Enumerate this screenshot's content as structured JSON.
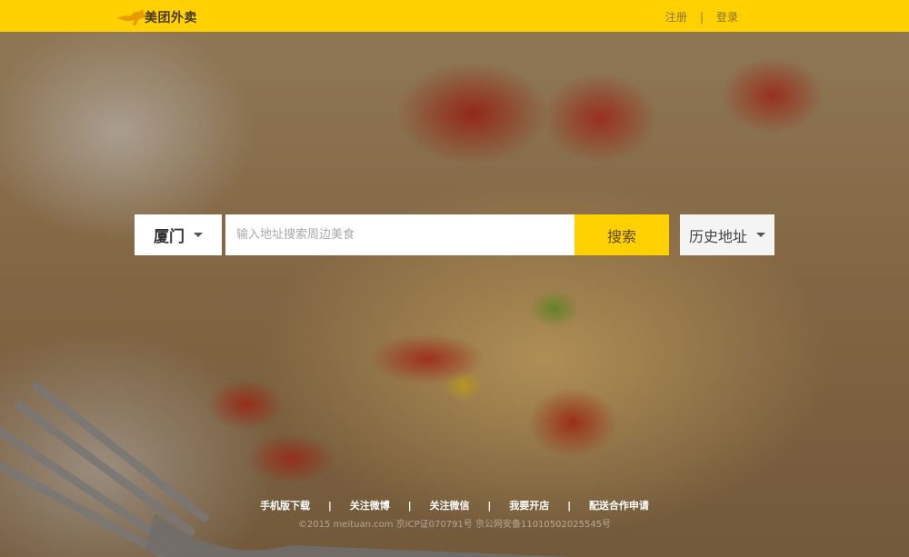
{
  "header": {
    "logo_text": "美团外卖",
    "logo_icon": "kangaroo-icon",
    "register_label": "注册",
    "separator": "|",
    "login_label": "登录"
  },
  "search": {
    "city": "厦门",
    "placeholder": "输入地址搜索周边美食",
    "value": "",
    "search_label": "搜索",
    "history_label": "历史地址"
  },
  "footer": {
    "links": [
      "手机版下载",
      "关注微博",
      "关注微信",
      "我要开店",
      "配送合作申请"
    ],
    "separator": "|",
    "copyright": "©2015 meituan.com 京ICP证070791号 京公网安备11010502025545号"
  },
  "colors": {
    "brand_yellow": "#ffd100",
    "header_text": "#8a7420"
  }
}
